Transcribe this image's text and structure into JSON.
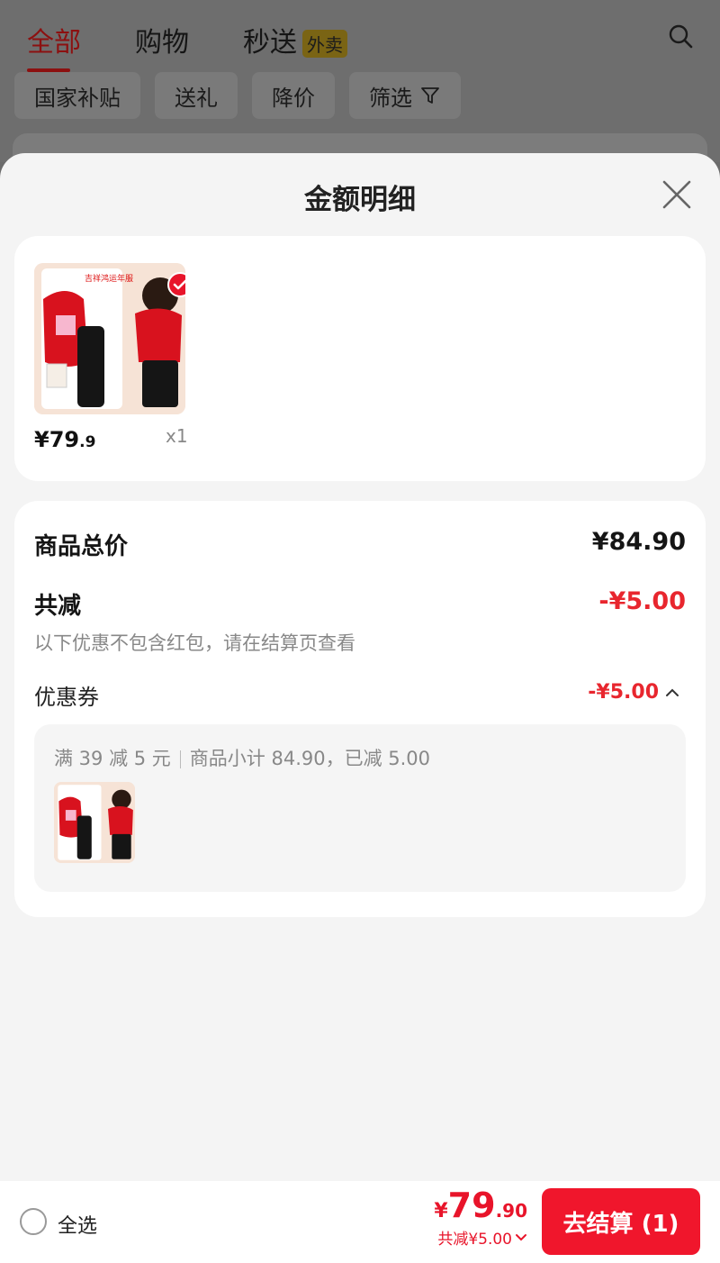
{
  "background": {
    "tabs": [
      {
        "label": "全部",
        "active": true
      },
      {
        "label": "购物",
        "active": false
      },
      {
        "label": "秒送",
        "active": false,
        "badge": "外卖"
      }
    ],
    "filters": [
      "国家补贴",
      "送礼",
      "降价",
      "筛选"
    ],
    "icons": {
      "search": "search-icon",
      "filter": "funnel-icon"
    }
  },
  "sheet": {
    "title": "金额明细",
    "close_icon": "close-icon"
  },
  "product": {
    "price_main": "¥79",
    "price_decimal": ".9",
    "quantity": "x1",
    "selected": true,
    "image_text": "吉祥鸿运年服"
  },
  "summary": {
    "total_label": "商品总价",
    "total_value": "¥84.90",
    "discount_label": "共减",
    "discount_value": "-¥5.00",
    "discount_note": "以下优惠不包含红包，请在结算页查看",
    "coupon_label": "优惠券",
    "coupon_value": "-¥5.00",
    "coupon_rule": "满 39 减 5 元",
    "coupon_detail": "商品小计 84.90，已减 5.00"
  },
  "bottom_bar": {
    "select_all": "全选",
    "currency": "¥",
    "total_int": "79",
    "total_dec": ".90",
    "saved": "共减¥5.00",
    "checkout": "去结算 (1)"
  },
  "colors": {
    "accent_red": "#f0162c",
    "discount_red": "#e8262e",
    "sheet_bg": "#f4f4f4",
    "overlay": "#6e6e6e"
  }
}
